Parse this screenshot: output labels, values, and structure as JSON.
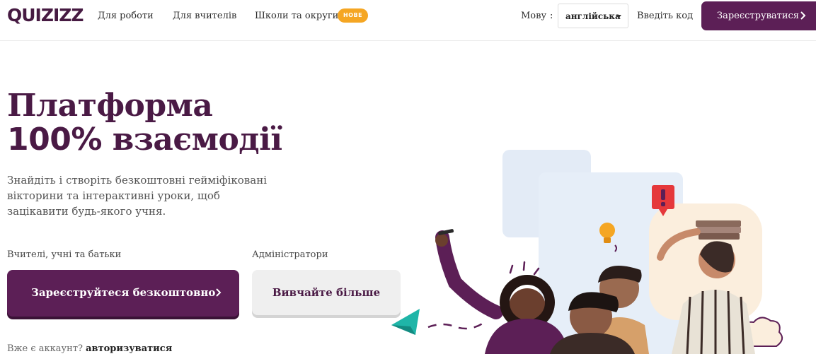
{
  "header": {
    "logo": "QUIZIZZ",
    "nav": [
      "Для роботи",
      "Для вчителів",
      "Школи та округи"
    ],
    "new_badge": "НОВЕ",
    "language_label": "Мову",
    "language_colon": ":",
    "language_value": "англійська",
    "enter_code": "Введіть код",
    "signup": "Зареєструватися"
  },
  "hero": {
    "title_line1": "Платформа",
    "title_pct": "100%",
    "title_word": "взаємодії",
    "subtitle": "Знайдіть і створіть безкоштовні гейміфіковані вікторини та інтерактивні уроки, щоб зацікавити будь-якого учня.",
    "teachers_label": "Вчителі, учні та батьки",
    "admins_label": "Адміністратори",
    "signup_free": "Зареєструйтеся безкоштовно",
    "learn_more": "Вивчайте більше",
    "have_account": "Вже є аккаунт?",
    "login": "авторизуватися"
  },
  "colors": {
    "brand": "#5c1f56",
    "title": "#4a1a45",
    "badge": "#f5a623",
    "accent_teal": "#1fb5a8",
    "alert_red": "#e5383b"
  },
  "icons": [
    "chevron-right-icon",
    "caret-down-icon",
    "paper-plane-icon",
    "exclamation-icon",
    "lightbulb-icon",
    "cloud-icon"
  ]
}
